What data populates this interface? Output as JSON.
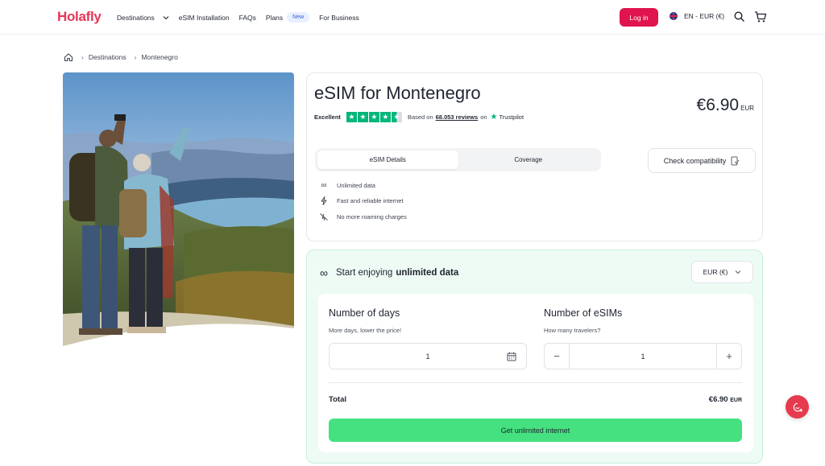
{
  "header": {
    "logo": "Holafly",
    "nav": [
      {
        "label": "Destinations"
      },
      {
        "label": "eSIM Installation"
      },
      {
        "label": "FAQs"
      },
      {
        "label": "Plans",
        "badge": "New"
      },
      {
        "label": "For Business"
      }
    ],
    "login_label": "Log in",
    "language": "EN - EUR (€)",
    "icons": [
      "search-icon",
      "cart-icon",
      "flag-uk-icon",
      "chevron-down-icon"
    ]
  },
  "breadcrumb": {
    "items": [
      "Destinations",
      "Montenegro"
    ],
    "icons": [
      "home-icon",
      "chevron-right-icon"
    ]
  },
  "product": {
    "title": "eSIM for Montenegro",
    "rating_word": "Excellent",
    "reviews_prefix": "Based on",
    "reviews_count": "68.053 reviews",
    "reviews_on": "on",
    "trustpilot": "Trustpilot",
    "stars": 4.5,
    "price": "€6.90",
    "price_currency": "EUR",
    "tabs": [
      {
        "label": "eSIM Details",
        "active": true
      },
      {
        "label": "Coverage",
        "active": false
      }
    ],
    "check_compat_label": "Check compatibility",
    "features": [
      {
        "icon": "infinity-icon",
        "label": "Unlimited data"
      },
      {
        "icon": "bolt-icon",
        "label": "Fast and reliable internet"
      },
      {
        "icon": "no-roaming-icon",
        "label": "No more roaming charges"
      }
    ]
  },
  "plan": {
    "heading_prefix": "Start enjoying",
    "heading_bold": "unlimited data",
    "currency_select": "EUR (€)",
    "days": {
      "title": "Number of days",
      "subtitle": "More days, lower the price!",
      "value": "1"
    },
    "esims": {
      "title": "Number of eSIMs",
      "subtitle": "How many travelers?",
      "value": "1",
      "minus": "−",
      "plus": "+"
    },
    "total_label": "Total",
    "total_value": "€6.90",
    "total_currency": "EUR",
    "cta_label": "Get unlimited internet"
  },
  "colors": {
    "brand": "#e6375a",
    "login": "#e0144e",
    "cta": "#45e180",
    "trustpilot": "#00b67a",
    "plan_bg": "#eefbf4"
  }
}
